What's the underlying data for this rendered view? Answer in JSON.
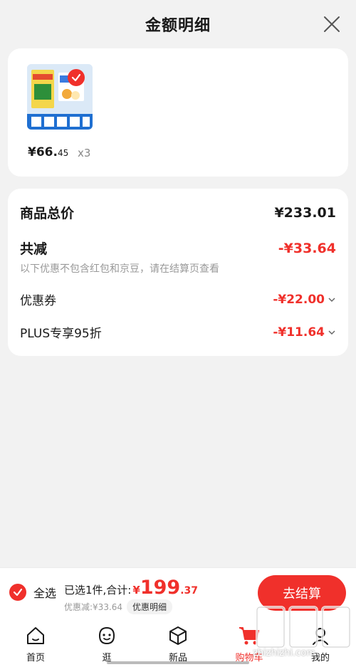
{
  "header": {
    "title": "金额明细"
  },
  "product": {
    "price_int": "¥66.",
    "price_cents": "45",
    "quantity": "x3",
    "selected": true
  },
  "detail": {
    "total_label": "商品总价",
    "total_value": "¥233.01",
    "reduce_label": "共减",
    "reduce_value": "-¥33.64",
    "note": "以下优惠不包含红包和京豆，请在结算页查看",
    "coupon_label": "优惠券",
    "coupon_value": "-¥22.00",
    "plus_label": "PLUS专享95折",
    "plus_value": "-¥11.64"
  },
  "checkout": {
    "select_all_label": "全选",
    "summary_text": "已选1件,合计:",
    "currency": "¥",
    "total_int": "199",
    "total_dec": ".37",
    "save_text": "优惠减:¥33.64",
    "detail_chip": "优惠明细",
    "checkout_label": "去结算"
  },
  "tabbar": {
    "tabs": [
      {
        "label": "首页",
        "icon": "home-icon"
      },
      {
        "label": "逛",
        "icon": "face-icon"
      },
      {
        "label": "新品",
        "icon": "box-icon"
      },
      {
        "label": "购物车",
        "icon": "cart-icon",
        "active": true
      },
      {
        "label": "我的",
        "icon": "person-icon"
      }
    ]
  },
  "watermark": {
    "text": "zhizhizhi.com"
  },
  "colors": {
    "accent": "#f0302b",
    "background": "#f2f2f2",
    "muted": "#999999"
  }
}
